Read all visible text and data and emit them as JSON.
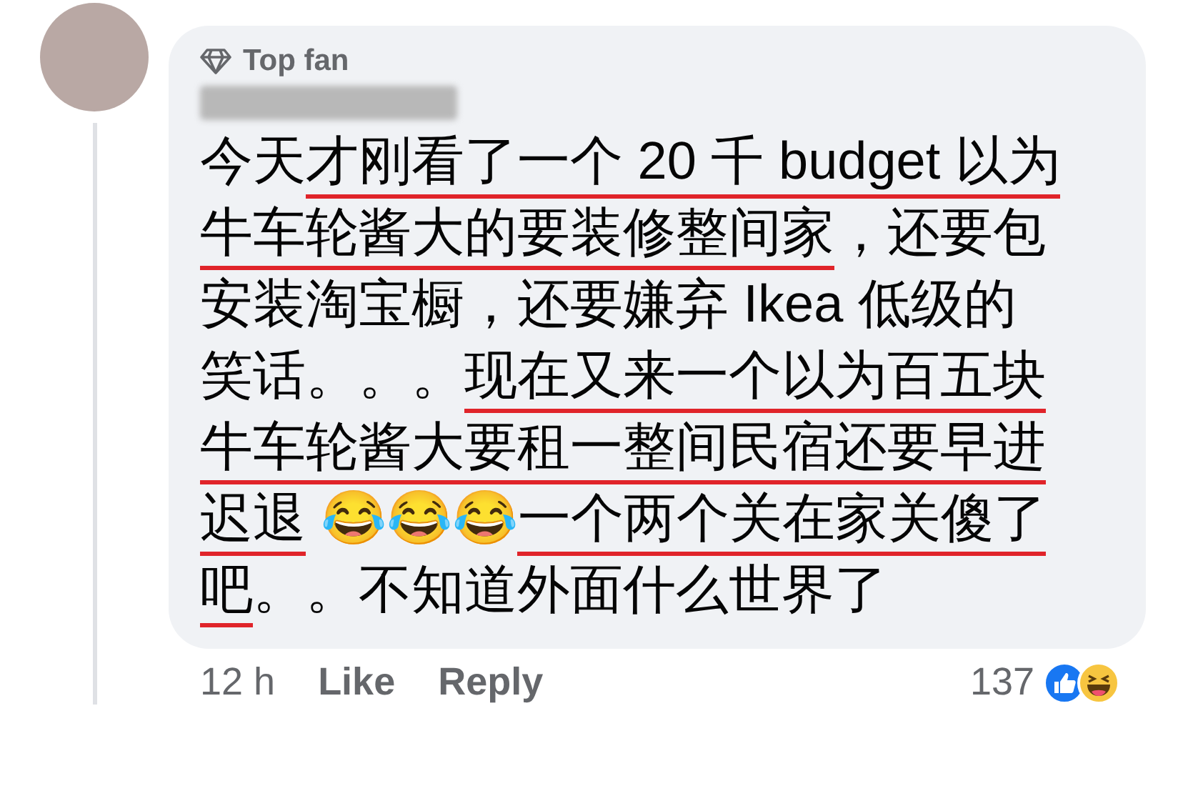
{
  "comment": {
    "badge": "Top fan",
    "segments": [
      {
        "text": "今天",
        "underlined": false
      },
      {
        "text": "才刚看了一个 20 千 budget 以为牛车轮酱大的要装修整间家",
        "underlined": true
      },
      {
        "text": "，还要包安装淘宝橱，还要嫌弃 Ikea 低级的笑话。。。",
        "underlined": false
      },
      {
        "text": "现在又来一个以为百五块牛车轮酱大要租一整间民宿还要早进迟退",
        "underlined": true
      },
      {
        "text": " 😂😂😂",
        "underlined": false
      },
      {
        "text": "一个两个关在家关傻了吧",
        "underlined": true
      },
      {
        "text": "。。不知道外面什么世界了",
        "underlined": false
      }
    ],
    "time": "12 h",
    "actions": [
      "Like",
      "Reply"
    ],
    "reaction_count": "137"
  }
}
